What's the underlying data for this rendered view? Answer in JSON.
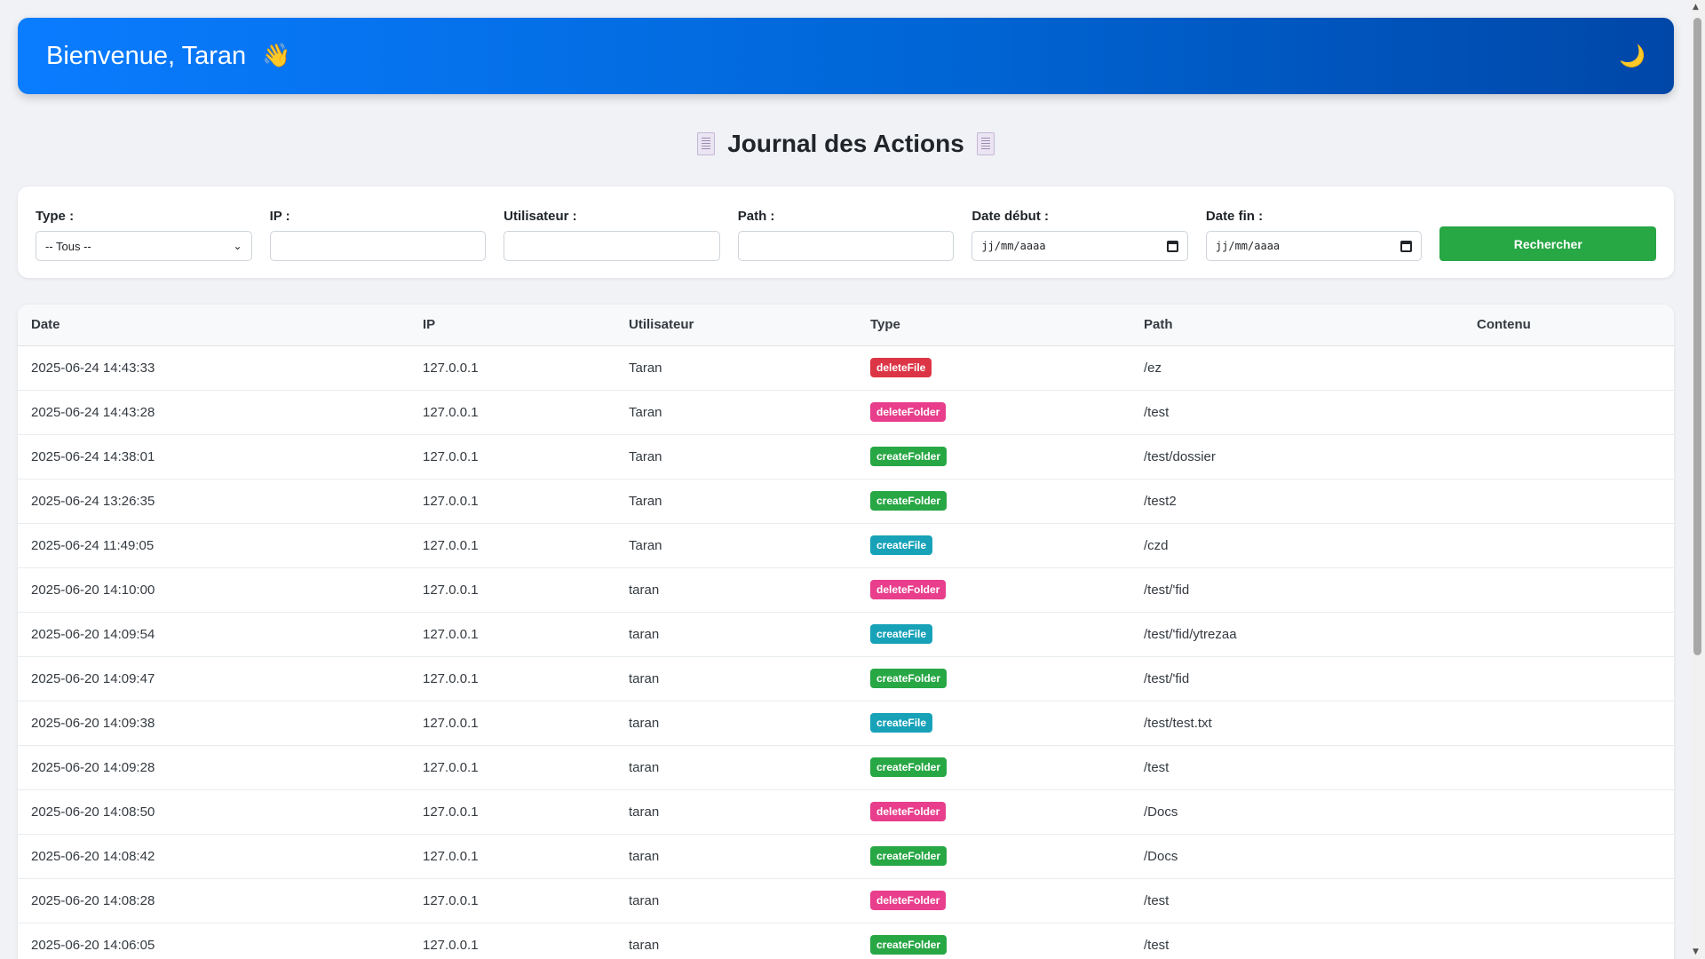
{
  "header": {
    "welcome": "Bienvenue, Taran",
    "wave_icon": "👋",
    "theme_icon": "🌙"
  },
  "page": {
    "title": "Journal des Actions"
  },
  "filters": {
    "type_label": "Type :",
    "type_value": "-- Tous --",
    "ip_label": "IP :",
    "ip_value": "",
    "user_label": "Utilisateur :",
    "user_value": "",
    "path_label": "Path :",
    "path_value": "",
    "date_start_label": "Date début :",
    "date_start_placeholder": "jj/mm/aaaa",
    "date_end_label": "Date fin :",
    "date_end_placeholder": "jj/mm/aaaa",
    "search_label": "Rechercher"
  },
  "table": {
    "columns": [
      "Date",
      "IP",
      "Utilisateur",
      "Type",
      "Path",
      "Contenu"
    ],
    "rows": [
      {
        "date": "2025-06-24 14:43:33",
        "ip": "127.0.0.1",
        "user": "Taran",
        "type": "deleteFile",
        "path": "/ez",
        "content": ""
      },
      {
        "date": "2025-06-24 14:43:28",
        "ip": "127.0.0.1",
        "user": "Taran",
        "type": "deleteFolder",
        "path": "/test",
        "content": ""
      },
      {
        "date": "2025-06-24 14:38:01",
        "ip": "127.0.0.1",
        "user": "Taran",
        "type": "createFolder",
        "path": "/test/dossier",
        "content": ""
      },
      {
        "date": "2025-06-24 13:26:35",
        "ip": "127.0.0.1",
        "user": "Taran",
        "type": "createFolder",
        "path": "/test2",
        "content": ""
      },
      {
        "date": "2025-06-24 11:49:05",
        "ip": "127.0.0.1",
        "user": "Taran",
        "type": "createFile",
        "path": "/czd",
        "content": ""
      },
      {
        "date": "2025-06-20 14:10:00",
        "ip": "127.0.0.1",
        "user": "taran",
        "type": "deleteFolder",
        "path": "/test/'fid",
        "content": ""
      },
      {
        "date": "2025-06-20 14:09:54",
        "ip": "127.0.0.1",
        "user": "taran",
        "type": "createFile",
        "path": "/test/'fid/ytrezaa",
        "content": ""
      },
      {
        "date": "2025-06-20 14:09:47",
        "ip": "127.0.0.1",
        "user": "taran",
        "type": "createFolder",
        "path": "/test/'fid",
        "content": ""
      },
      {
        "date": "2025-06-20 14:09:38",
        "ip": "127.0.0.1",
        "user": "taran",
        "type": "createFile",
        "path": "/test/test.txt",
        "content": ""
      },
      {
        "date": "2025-06-20 14:09:28",
        "ip": "127.0.0.1",
        "user": "taran",
        "type": "createFolder",
        "path": "/test",
        "content": ""
      },
      {
        "date": "2025-06-20 14:08:50",
        "ip": "127.0.0.1",
        "user": "taran",
        "type": "deleteFolder",
        "path": "/Docs",
        "content": ""
      },
      {
        "date": "2025-06-20 14:08:42",
        "ip": "127.0.0.1",
        "user": "taran",
        "type": "createFolder",
        "path": "/Docs",
        "content": ""
      },
      {
        "date": "2025-06-20 14:08:28",
        "ip": "127.0.0.1",
        "user": "taran",
        "type": "deleteFolder",
        "path": "/test",
        "content": ""
      },
      {
        "date": "2025-06-20 14:06:05",
        "ip": "127.0.0.1",
        "user": "taran",
        "type": "createFolder",
        "path": "/test",
        "content": ""
      }
    ]
  },
  "colors": {
    "header_start": "#0a7cff",
    "header_end": "#0047a8",
    "deleteFile": "#dc3545",
    "deleteFolder": "#e83e8c",
    "createFolder": "#28a745",
    "createFile": "#17a2b8",
    "search_button": "#28a745"
  }
}
